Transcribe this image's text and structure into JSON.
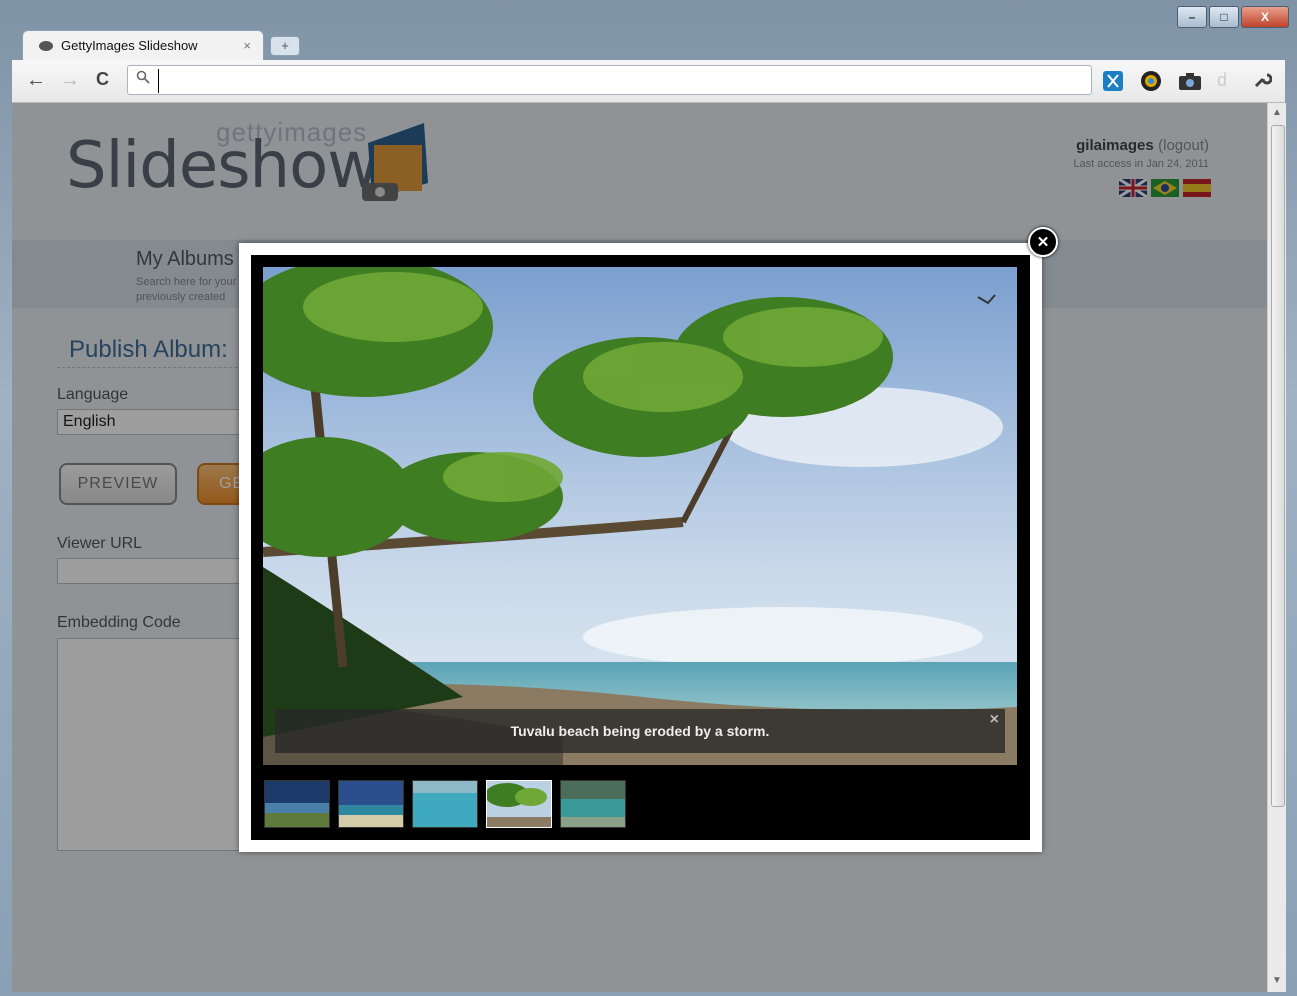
{
  "window": {
    "minimize": "–",
    "maximize": "□",
    "close": "X"
  },
  "tab": {
    "title": "GettyImages Slideshow",
    "close": "×",
    "new_tab": "+"
  },
  "toolbar": {
    "back": "←",
    "forward": "→",
    "reload": "C",
    "search_icon": "🔍",
    "address_value": ""
  },
  "header": {
    "getty": "gettyimages",
    "slideshow": "Slideshow",
    "user": "gilaimages",
    "logout": "(logout)",
    "last_access": "Last access in Jan 24, 2011",
    "flags": [
      "uk-flag-icon",
      "brazil-flag-icon",
      "spain-flag-icon"
    ]
  },
  "nav": {
    "albums_title": "My Albums",
    "albums_desc": "Search here for your previously created"
  },
  "publish": {
    "title": "Publish Album:",
    "language_label": "Language",
    "language_value": "English",
    "preview_button": "PREVIEW",
    "get_button": "GE",
    "viewer_url_label": "Viewer URL",
    "embedding_label": "Embedding Code"
  },
  "lightbox": {
    "caption": "Tuvalu beach being eroded by a storm.",
    "caption_close": "×",
    "close": "✕",
    "thumbnails": [
      "thumb-1",
      "thumb-2",
      "thumb-3",
      "thumb-4",
      "thumb-5"
    ],
    "active_thumbnail": 4
  }
}
